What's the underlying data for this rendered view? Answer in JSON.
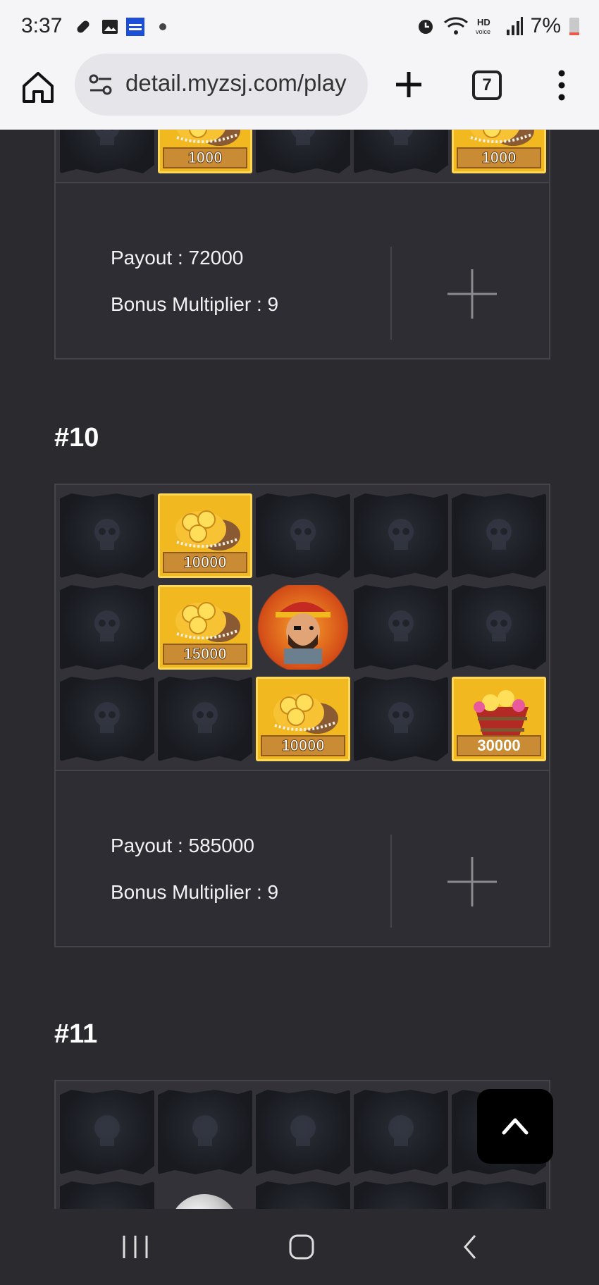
{
  "status_bar": {
    "time": "3:37",
    "battery": "7%",
    "icons": [
      "pill-icon",
      "gallery-icon",
      "bank-app-icon",
      "dot-icon",
      "alarm-icon",
      "wifi-icon",
      "hd-voice-icon",
      "signal-icon",
      "battery-icon"
    ]
  },
  "browser": {
    "url": "detail.myzsj.com/play",
    "tab_count": "7"
  },
  "rounds": [
    {
      "grid_last_row": [
        {
          "type": "flag"
        },
        {
          "type": "coin",
          "value": "1000"
        },
        {
          "type": "flag"
        },
        {
          "type": "flag"
        },
        {
          "type": "coin",
          "value": "1000"
        }
      ],
      "payout": "Payout : 72000",
      "bonus": "Bonus Multiplier : 9"
    },
    {
      "title": "#10",
      "grid": [
        {
          "type": "flag"
        },
        {
          "type": "coin",
          "value": "10000"
        },
        {
          "type": "flag"
        },
        {
          "type": "flag"
        },
        {
          "type": "flag"
        },
        {
          "type": "flag"
        },
        {
          "type": "coin",
          "value": "15000"
        },
        {
          "type": "pirate"
        },
        {
          "type": "flag"
        },
        {
          "type": "flag"
        },
        {
          "type": "flag"
        },
        {
          "type": "flag"
        },
        {
          "type": "coin",
          "value": "10000"
        },
        {
          "type": "flag"
        },
        {
          "type": "barrel",
          "value": "30000"
        }
      ],
      "payout": "Payout : 585000",
      "bonus": "Bonus Multiplier : 9"
    },
    {
      "title": "#11"
    }
  ],
  "colors": {
    "background": "#2b2a2f",
    "card": "#2e2d33",
    "gold": "#f2b820"
  }
}
